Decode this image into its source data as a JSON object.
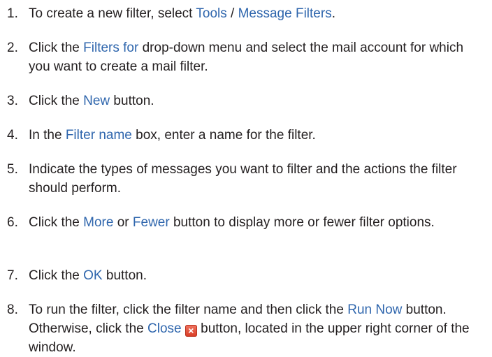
{
  "steps": [
    {
      "num": "1.",
      "segments": [
        {
          "text": "To create a new filter, select "
        },
        {
          "text": "Tools",
          "hl": true
        },
        {
          "text": " / "
        },
        {
          "text": "Message Filters",
          "hl": true
        },
        {
          "text": "."
        }
      ]
    },
    {
      "num": "2.",
      "segments": [
        {
          "text": "Click the "
        },
        {
          "text": "Filters for",
          "hl": true
        },
        {
          "text": " drop-down menu and select the mail account for which you want to create a mail filter."
        }
      ]
    },
    {
      "num": "3.",
      "segments": [
        {
          "text": "Click the "
        },
        {
          "text": "New",
          "hl": true
        },
        {
          "text": " button."
        }
      ]
    },
    {
      "num": "4.",
      "segments": [
        {
          "text": "In the "
        },
        {
          "text": "Filter name",
          "hl": true
        },
        {
          "text": " box, enter a name for the filter."
        }
      ]
    },
    {
      "num": "5.",
      "segments": [
        {
          "text": "Indicate the types of messages you want to filter and the actions the filter should perform."
        }
      ]
    },
    {
      "num": "6.",
      "segments": [
        {
          "text": "Click the "
        },
        {
          "text": "More",
          "hl": true
        },
        {
          "text": " or "
        },
        {
          "text": "Fewer",
          "hl": true
        },
        {
          "text": " button to display more or fewer filter options."
        }
      ]
    },
    {
      "num": "7.",
      "segments": [
        {
          "text": "Click the "
        },
        {
          "text": "OK",
          "hl": true
        },
        {
          "text": " button."
        }
      ]
    },
    {
      "num": "8.",
      "segments": [
        {
          "text": "To run the filter, click the filter name and then click the "
        },
        {
          "text": "Run Now",
          "hl": true
        },
        {
          "text": " button. Otherwise, click the "
        },
        {
          "text": "Close",
          "hl": true
        },
        {
          "text": " "
        },
        {
          "icon": "close-icon"
        },
        {
          "text": " button, located in the upper right corner of the window."
        }
      ]
    }
  ],
  "colors": {
    "text": "#231f20",
    "highlight": "#2f66ad",
    "close_icon": "#e04a33"
  }
}
